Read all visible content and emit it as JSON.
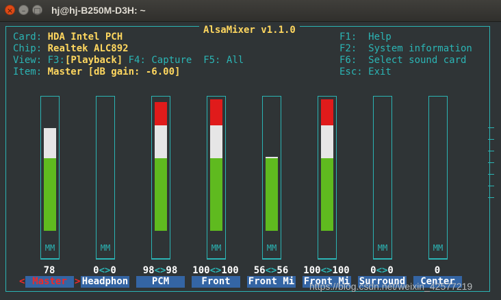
{
  "window": {
    "title": "hj@hj-B250M-D3H: ~",
    "close": "×",
    "minimize": "–",
    "maximize": "□"
  },
  "app": {
    "title": "AlsaMixer v1.1.0"
  },
  "info": {
    "card_label": "Card:",
    "card": "HDA Intel PCH",
    "chip_label": "Chip:",
    "chip": "Realtek ALC892",
    "view_label": "View:",
    "view_f3": "F3:",
    "view_playback": "[Playback]",
    "view_f4": "F4: Capture",
    "view_f5": "F5: All",
    "item_label": "Item:",
    "item": "Master [dB gain: -6.00]"
  },
  "help": {
    "f1": "F1:  Help",
    "f2": "F2:  System information",
    "f6": "F6:  Select sound card",
    "esc": "Esc: Exit"
  },
  "colors": {
    "green": "#5fba1f",
    "white": "#e6e6e6",
    "red": "#e01b1b",
    "accent": "#2bb5b5"
  },
  "channels": [
    {
      "name": "Master",
      "left": "78",
      "sep": "",
      "right": "",
      "level": 0.78,
      "mute": "MM",
      "selected": true
    },
    {
      "name": "Headphon",
      "left": "0",
      "sep": "<>",
      "right": "0",
      "level": 0,
      "mute": "MM",
      "selected": false
    },
    {
      "name": "PCM",
      "left": "98",
      "sep": "<>",
      "right": "98",
      "level": 0.98,
      "mute": "",
      "selected": false
    },
    {
      "name": "Front",
      "left": "100",
      "sep": "<>",
      "right": "100",
      "level": 1.0,
      "mute": "MM",
      "selected": false
    },
    {
      "name": "Front Mi",
      "left": "56",
      "sep": "<>",
      "right": "56",
      "level": 0.56,
      "mute": "MM",
      "selected": false
    },
    {
      "name": "Front Mi",
      "left": "100",
      "sep": "<>",
      "right": "100",
      "level": 1.0,
      "mute": "",
      "selected": false
    },
    {
      "name": "Surround",
      "left": "0",
      "sep": "<>",
      "right": "0",
      "level": 0,
      "mute": "MM",
      "selected": false
    },
    {
      "name": "Center",
      "left": "0",
      "sep": "",
      "right": "",
      "level": 0,
      "mute": "MM",
      "selected": false
    }
  ],
  "selection_markers": {
    "left": "<",
    "right": ">"
  },
  "watermark": "https://blog.csdn.net/weixin_42577219"
}
